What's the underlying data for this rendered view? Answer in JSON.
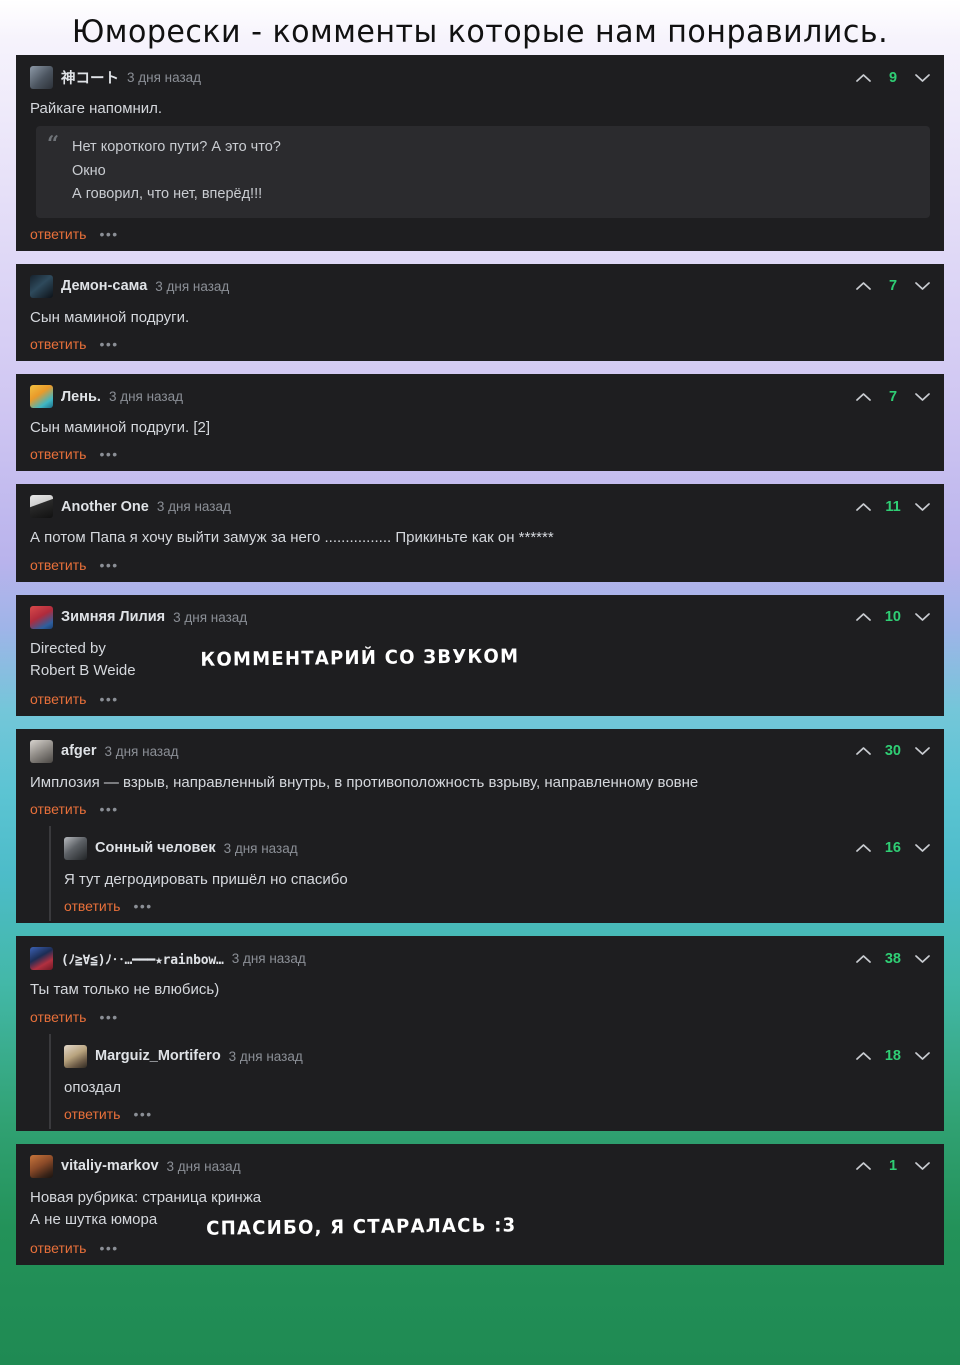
{
  "page": {
    "title": "Юморески - комменты которые нам понравились.",
    "reply_label": "ответить",
    "dots_label": "•••",
    "timestamp": "3 дня назад"
  },
  "colors": {
    "comment_bg": "#1e1e20",
    "quote_bg": "#2b2b2e",
    "score_green": "#2fce74",
    "reply_orange": "#e8703a",
    "username": "#dfe2e6",
    "body_text": "#d5d8dd",
    "muted": "#8b8f96"
  },
  "overlays": {
    "sound_comment": "КОММЕНТАРИЙ СО ЗВУКОМ",
    "thanks": "СПАСИБО, Я СТАРАЛАСЬ :3"
  },
  "threads": [
    {
      "id": "t1",
      "username": "神コート",
      "time": "3 дня назад",
      "score": "9",
      "body": [
        "Райкаге напомнил."
      ],
      "quote": [
        "Нет короткого пути? А это что?",
        "Окно",
        "А говорил, что нет, вперёд!!!"
      ],
      "replies": []
    },
    {
      "id": "t2",
      "username": "Демон-сама",
      "time": "3 дня назад",
      "score": "7",
      "body": [
        "Сын маминой подруги."
      ],
      "quote": [],
      "replies": []
    },
    {
      "id": "t3",
      "username": "Лень.",
      "time": "3 дня назад",
      "score": "7",
      "body": [
        "Сын маминой подруги. [2]"
      ],
      "quote": [],
      "replies": []
    },
    {
      "id": "t4",
      "username": "Another One",
      "time": "3 дня назад",
      "score": "11",
      "body": [
        "А потом Папа я хочу выйти замуж за него ................ Прикиньте как он ******"
      ],
      "quote": [],
      "replies": []
    },
    {
      "id": "t5",
      "username": "Зимняя Лилия",
      "time": "3 дня назад",
      "score": "10",
      "body": [
        "Directed by",
        "Robert B Weide"
      ],
      "quote": [],
      "replies": []
    },
    {
      "id": "t6",
      "username": "afger",
      "time": "3 дня назад",
      "score": "30",
      "body": [
        "Имплозия — взрыв, направленный внутрь, в противоположность взрыву, направленному вовне"
      ],
      "quote": [],
      "replies": [
        {
          "id": "t6r1",
          "username": "Сонный человек",
          "time": "3 дня назад",
          "score": "16",
          "body": [
            "Я тут дегродировать пришёл но спасибо"
          ]
        }
      ]
    },
    {
      "id": "t7",
      "username": "(ﾉ≧∀≦)ﾉ‥…━━━★rainbow…",
      "time": "3 дня назад",
      "score": "38",
      "body": [
        "Ты там только не влюбись)"
      ],
      "quote": [],
      "replies": [
        {
          "id": "t7r1",
          "username": "Marguiz_Mortifero",
          "time": "3 дня назад",
          "score": "18",
          "body": [
            "опоздал"
          ]
        }
      ]
    },
    {
      "id": "t8",
      "username": "vitaliy-markov",
      "time": "3 дня назад",
      "score": "1",
      "body": [
        "Новая рубрика: страница кринжа",
        "А не шутка юмора"
      ],
      "quote": [],
      "replies": []
    }
  ]
}
